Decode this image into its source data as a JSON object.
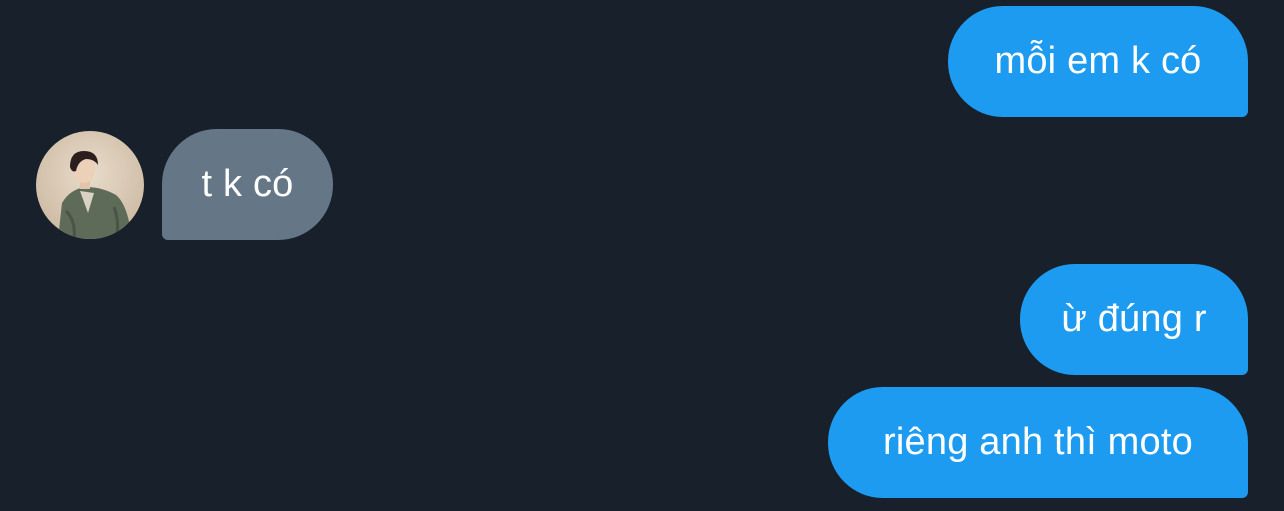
{
  "messages": [
    {
      "id": "m1",
      "direction": "outgoing",
      "text": "mỗi em k có"
    },
    {
      "id": "m2",
      "direction": "incoming",
      "text": "t k có",
      "avatar": "user-photo"
    },
    {
      "id": "m3",
      "direction": "outgoing",
      "text": "ừ đúng r"
    },
    {
      "id": "m4",
      "direction": "outgoing",
      "text": "riêng anh thì moto"
    }
  ],
  "colors": {
    "background": "#17202b",
    "outgoing_bubble": "#1d9bf0",
    "incoming_bubble": "#657786",
    "text": "#ffffff"
  }
}
